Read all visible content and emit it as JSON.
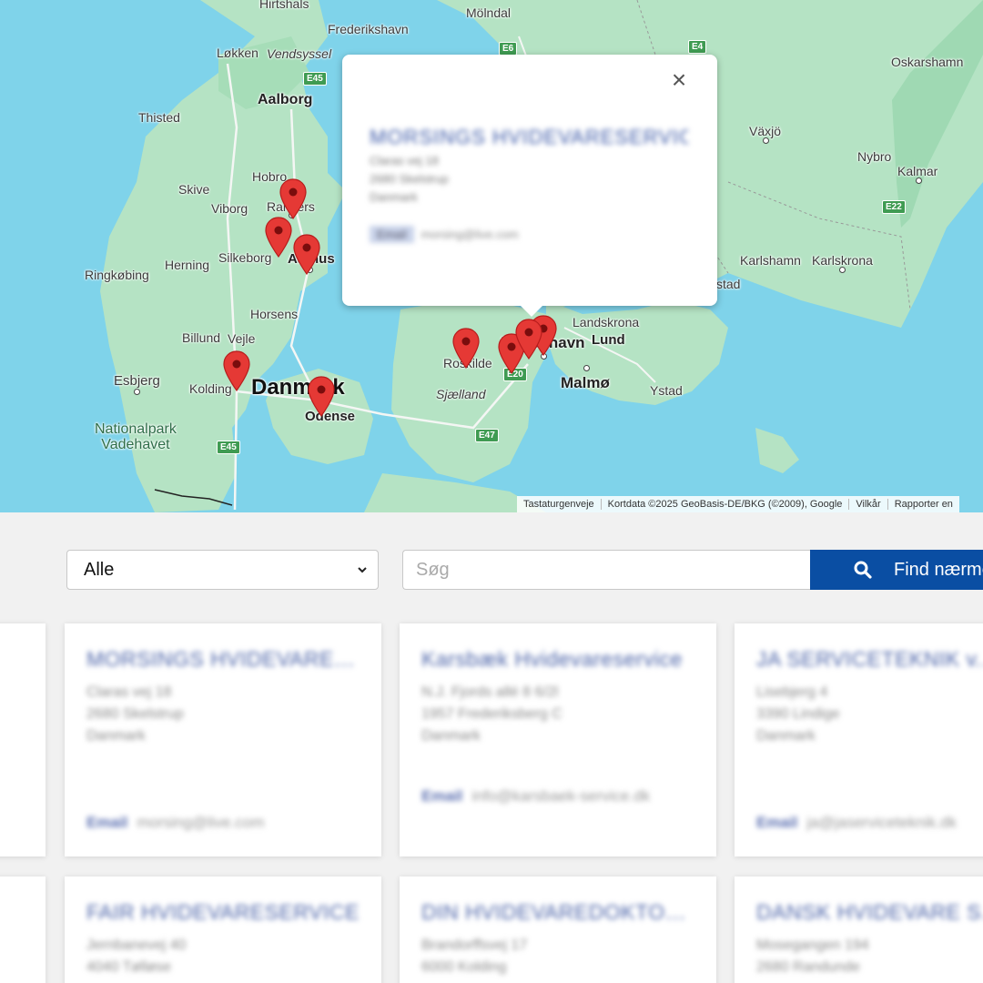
{
  "map": {
    "labels": {
      "hirtshals": "Hirtshals",
      "frederikshavn": "Frederikshavn",
      "molndal": "Mölndal",
      "lokken": "Løkken",
      "vendsyssel": "Vendsyssel",
      "aalborg": "Aalborg",
      "thisted": "Thisted",
      "hobro": "Hobro",
      "skive": "Skive",
      "viborg": "Viborg",
      "randers": "Randers",
      "herning": "Herning",
      "silkeborg": "Silkeborg",
      "aarhus": "Aarhus",
      "ringkobing": "Ringkøbing",
      "horsens": "Horsens",
      "billund": "Billund",
      "vejle": "Vejle",
      "esbjerg": "Esbjerg",
      "kolding": "Kolding",
      "danmark": "Danmark",
      "odense": "Odense",
      "nationalpark": "Nationalpark\nVadehavet",
      "roskilde": "Roskilde",
      "sjaelland": "Sjælland",
      "kobenhavn": "København",
      "landskrona": "Landskrona",
      "lund": "Lund",
      "malmo": "Malmø",
      "ystad": "Ystad",
      "oskarshamn": "Oskarshamn",
      "vaxjo": "Växjö",
      "nybro": "Nybro",
      "kalmar": "Kalmar",
      "karlshamn": "Karlshamn",
      "karlskrona": "Karlskrona",
      "stad": "stad"
    },
    "roads": [
      "E45",
      "E6",
      "E4",
      "E22",
      "E20",
      "E47",
      "E45"
    ],
    "attribution": [
      "Tastaturgenveje",
      "Kortdata ©2025 GeoBasis-DE/BKG (©2009), Google",
      "Vilkår",
      "Rapporter en"
    ]
  },
  "popup": {
    "close_label": "×",
    "title": "MORSINGS HVIDEVARESERVICE",
    "lines": [
      "Claras vej 18",
      "2680 Skelstrup",
      "Danmark"
    ],
    "email_label": "Email",
    "email_value": "morsing@live.com"
  },
  "filter": {
    "select_value": "Alle",
    "search_placeholder": "Søg",
    "find_label": "Find nærmeste"
  },
  "cards": [
    {
      "name": "MORSINGS HVIDEVARESERVICE",
      "lines": [
        "Claras vej 18",
        "2680 Skelstrup",
        "Danmark"
      ],
      "email_label": "Email",
      "email_value": "morsing@live.com"
    },
    {
      "name": "Karsbæk Hvidevareservice",
      "lines": [
        "N.J. Fjords allé 8 6/2l",
        "1957 Frederiksberg C",
        "Danmark"
      ],
      "email_label": "Email",
      "email_value": "info@karsbaek-service.dk"
    },
    {
      "name": "JA SERVICETEKNIK v./JAN",
      "lines": [
        "Lisebjerg 4",
        "3390 Lindige",
        "Danmark"
      ],
      "email_label": "Email",
      "email_value": "ja@jaserviceteknik.dk"
    },
    {
      "name": "FAIR HVIDEVARESERVICE",
      "lines": [
        "Jernbanevej 40",
        "4040 Tølløse"
      ],
      "email_label": "",
      "email_value": ""
    },
    {
      "name": "DIN HVIDEVAREDOKTOR ApS",
      "lines": [
        "Brandorffsvej 17",
        "6000 Kolding"
      ],
      "email_label": "",
      "email_value": ""
    },
    {
      "name": "DANSK HVIDEVARE SERVICE",
      "lines": [
        "Mosegangen 194",
        "2680 Randunde"
      ],
      "email_label": "",
      "email_value": ""
    }
  ]
}
